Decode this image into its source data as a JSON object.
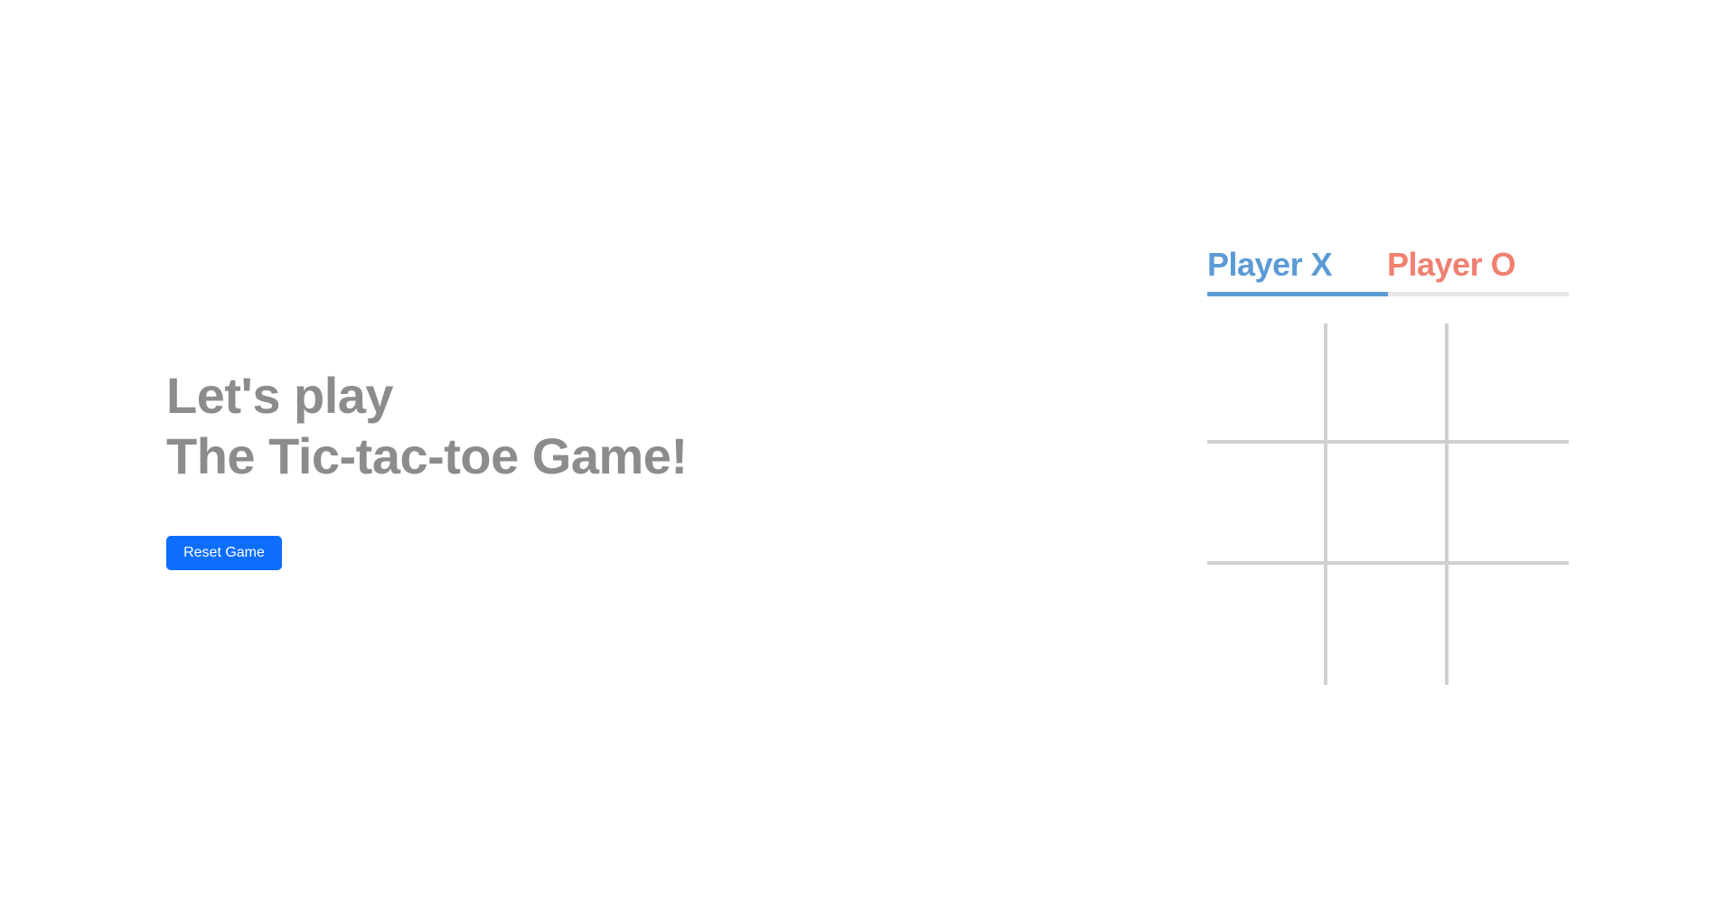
{
  "intro": {
    "line1": "Let's play",
    "line2": "The Tic-tac-toe Game!"
  },
  "controls": {
    "reset_label": "Reset Game"
  },
  "players": {
    "x": {
      "label": "Player X",
      "color": "#5b9bd5"
    },
    "o": {
      "label": "Player O",
      "color": "#f08070"
    },
    "current_turn": "x"
  },
  "colors": {
    "heading": "#8c8c8c",
    "button": "#0d6efd",
    "grid_lines": "#d0d0d0",
    "turn_track": "#e8e8e8"
  },
  "board": {
    "cells": [
      "",
      "",
      "",
      "",
      "",
      "",
      "",
      "",
      ""
    ]
  }
}
